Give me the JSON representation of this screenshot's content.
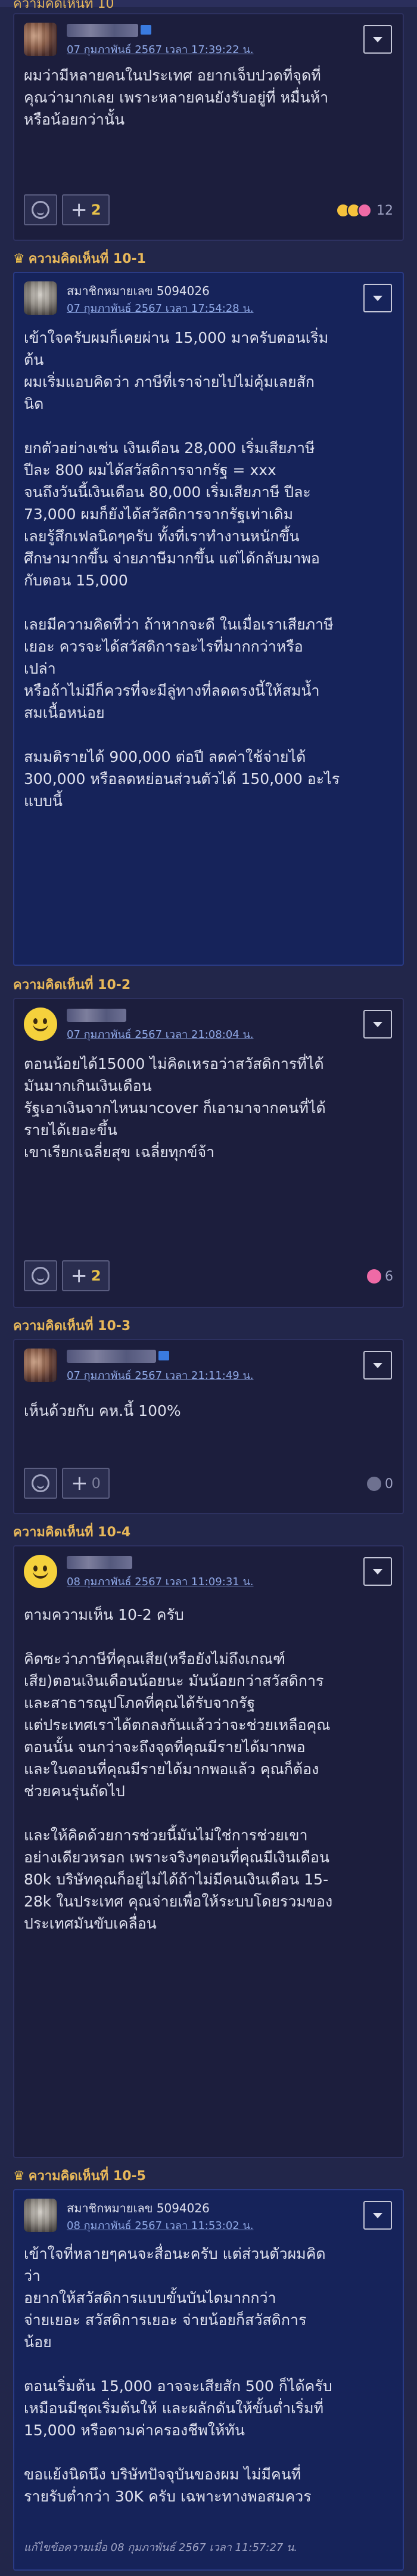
{
  "top_section": {
    "label": "ความคิดเห็นที่ 10"
  },
  "comments": [
    {
      "id": "c10",
      "author": "",
      "timestamp": "07 กุมภาพันธ์ 2567 เวลา 17:39:22 น.",
      "body": [
        "ผมว่ามีหลายคนในประเทศ อยากเจ็บปวดที่จุดที่",
        "คุณว่ามากเลย เพราะหลายคนยังรับอยู่ที่ หมื่นห้า",
        "หรือน้อยกว่านั้น"
      ],
      "plus_count": "2",
      "reaction_count": "12"
    },
    {
      "id": "c10-1",
      "section_label": "ความคิดเห็นที่ 10-1",
      "author": "สมาชิกหมายเลข 5094026",
      "timestamp": "07 กุมภาพันธ์ 2567 เวลา 17:54:28 น.",
      "body": [
        "เข้าใจครับผมก็เคยผ่าน 15,000 มาครับตอนเริ่ม",
        "ต้น",
        "ผมเริ่มแอบคิดว่า ภาษีที่เราจ่ายไปไม่คุ้มเลยสัก",
        "นิด",
        "",
        "ยกตัวอย่างเช่น เงินเดือน 28,000 เริ่มเสียภาษี",
        "ปีละ 800 ผมได้สวัสดิการจากรัฐ = xxx",
        "จนถึงวันนี้เงินเดือน 80,000 เริ่มเสียภาษี ปีละ",
        "73,000 ผมก็ยังได้สวัสดิการจากรัฐเท่าเดิม",
        "เลยรู้สึกเฟลนิดๆครับ ทั้งที่เราทำงานหนักขึ้น",
        "ศึกษามากขึ้น จ่ายภาษีมากขึ้น แต่ได้กลับมาพอ",
        "กับตอน 15,000",
        "",
        "เลยมีความคิดที่ว่า ถ้าหากจะดี ในเมื่อเราเสียภาษี",
        "เยอะ ควรจะได้สวัสดิการอะไรที่มากกว่าหรือ",
        "เปล่า",
        "หรือถ้าไม่มีก็ควรที่จะมีลู่ทางที่ลดตรงนี้ให้สมน้ำ",
        "สมเนื้อหน่อย",
        "",
        "สมมติรายได้ 900,000 ต่อปี ลดค่าใช้จ่ายได้",
        "300,000 หรือลดหย่อนส่วนตัวได้ 150,000 อะไร",
        "แบบนี้"
      ]
    },
    {
      "id": "c10-2",
      "section_label": "ความคิดเห็นที่ 10-2",
      "author": "",
      "timestamp": "07 กุมภาพันธ์ 2567 เวลา 21:08:04 น.",
      "body": [
        "ตอนน้อยได้15000 ไม่คิดเหรอว่าสวัสดิการที่ได้",
        "มันมากเกินเงินเดือน",
        "รัฐเอาเงินจากไหนมาcover ก็เอามาจากคนที่ได้",
        "รายได้เยอะขึ้น",
        "เขาเรียกเฉลี่ยสุข เฉลี่ยทุกข์จ้า"
      ],
      "plus_count": "2",
      "reaction_count": "6"
    },
    {
      "id": "c10-3",
      "section_label": "ความคิดเห็นที่ 10-3",
      "author": "",
      "timestamp": "07 กุมภาพันธ์ 2567 เวลา 21:11:49 น.",
      "body": [
        "เห็นด้วยกับ คห.นี้ 100%"
      ],
      "plus_count": "0",
      "reaction_count": "0"
    },
    {
      "id": "c10-4",
      "section_label": "ความคิดเห็นที่ 10-4",
      "author": "",
      "timestamp": "08 กุมภาพันธ์ 2567 เวลา 11:09:31 น.",
      "body": [
        "ตามความเห็น 10-2 ครับ",
        "",
        "คิดซะว่าภาษีที่คุณเสีย(หรือยังไม่ถึงเกณฑ์",
        "เสีย)ตอนเงินเดือนน้อยนะ มันน้อยกว่าสวัสดิการ",
        "และสาธารณูปโภคที่คุณได้รับจากรัฐ",
        "แต่ประเทศเราได้ตกลงกันแล้วว่าจะช่วยเหลือคุณ",
        "ตอนนั้น จนกว่าจะถึงจุดที่คุณมีรายได้มากพอ",
        "และในตอนที่คุณมีรายได้มากพอแล้ว คุณก็ต้อง",
        "ช่วยคนรุ่นถัดไป",
        "",
        "และให้คิดด้วยการช่วยนี้มันไม่ใช่การช่วยเขา",
        "อย่างเดียวหรอก เพราะจริงๆตอนที่คุณมีเงินเดือน",
        "80k บริษัทคุณก็อยู่ไม่ได้ถ้าไม่มีคนเงินเดือน 15-",
        "28k ในประเทศ คุณจ่ายเพื่อให้ระบบโดยรวมของ",
        "ประเทศมันขับเคลื่อน"
      ]
    },
    {
      "id": "c10-5",
      "section_label": "ความคิดเห็นที่ 10-5",
      "author": "สมาชิกหมายเลข 5094026",
      "timestamp": "08 กุมภาพันธ์ 2567 เวลา 11:53:02 น.",
      "body": [
        "เข้าใจที่หลายๆคนจะสื่อนะครับ แต่ส่วนตัวผมคิด",
        "ว่า",
        "อยากให้สวัสดิการแบบขั้นบันไดมากกว่า",
        "จ่ายเยอะ สวัสดิการเยอะ จ่ายน้อยก็สวัสดิการ",
        "น้อย",
        "",
        "ตอนเริ่มต้น 15,000 อาจจะเสียสัก 500 ก็ได้ครับ",
        "เหมือนมีชุดเริ่มต้นให้ และผลักดันให้ขั้นต่ำเริ่มที่",
        "15,000 หรือตามค่าครองชีพให้ทัน",
        "",
        "ขอแย้งนิดนึง บริษัทปัจจุบันของผม ไม่มีคนที่",
        "รายรับต่ำกว่า 30K ครับ เฉพาะทางพอสมควร"
      ],
      "edit_note": "แก้ไขข้อความเมื่อ 08 กุมภาพันธ์ 2567 เวลา 11:57:27 น."
    }
  ]
}
